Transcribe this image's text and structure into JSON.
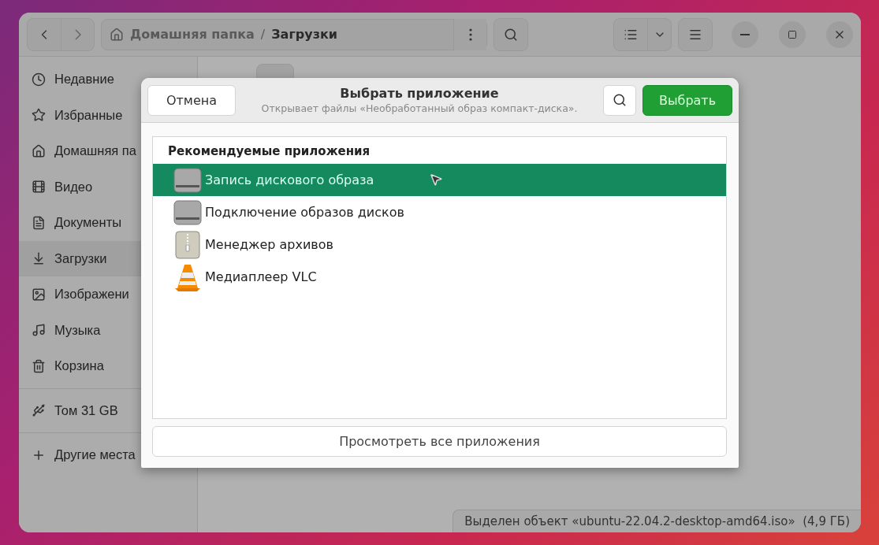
{
  "header": {
    "path": [
      {
        "label": "Домашняя папка",
        "kind": "home"
      },
      {
        "label": "/",
        "kind": "separator"
      },
      {
        "label": "Загрузки",
        "kind": "current"
      }
    ]
  },
  "sidebar": {
    "groups": [
      [
        {
          "label": "Недавние",
          "selected": false
        },
        {
          "label": "Избранные",
          "selected": false
        },
        {
          "label": "Домашняя па",
          "selected": false
        },
        {
          "label": "Видео",
          "selected": false
        },
        {
          "label": "Документы",
          "selected": false
        },
        {
          "label": "Загрузки",
          "selected": true
        },
        {
          "label": "Изображени",
          "selected": false
        },
        {
          "label": "Музыка",
          "selected": false
        },
        {
          "label": "Корзина",
          "selected": false
        }
      ],
      [
        {
          "label": "Том 31 GB",
          "selected": false
        }
      ],
      [
        {
          "label": "Другие места",
          "selected": false
        }
      ]
    ]
  },
  "dialog": {
    "cancel": "Отмена",
    "title": "Выбрать приложение",
    "subtitle": "Открывает файлы «Необработанный образ компакт-диска».",
    "confirm": "Выбрать",
    "section": "Рекомендуемые приложения",
    "apps": [
      {
        "name": "Запись дискового образа",
        "kind": "disk",
        "selected": true
      },
      {
        "name": "Подключение образов дисков",
        "kind": "disk",
        "selected": false
      },
      {
        "name": "Менеджер архивов",
        "kind": "archive",
        "selected": false
      },
      {
        "name": "Медиаплеер VLC",
        "kind": "cone",
        "selected": false
      }
    ],
    "view_all": "Просмотреть все приложения"
  },
  "status_bar": "Выделен объект «ubuntu-22.04.2-desktop-amd64.iso»  (4,9 ГБ)"
}
